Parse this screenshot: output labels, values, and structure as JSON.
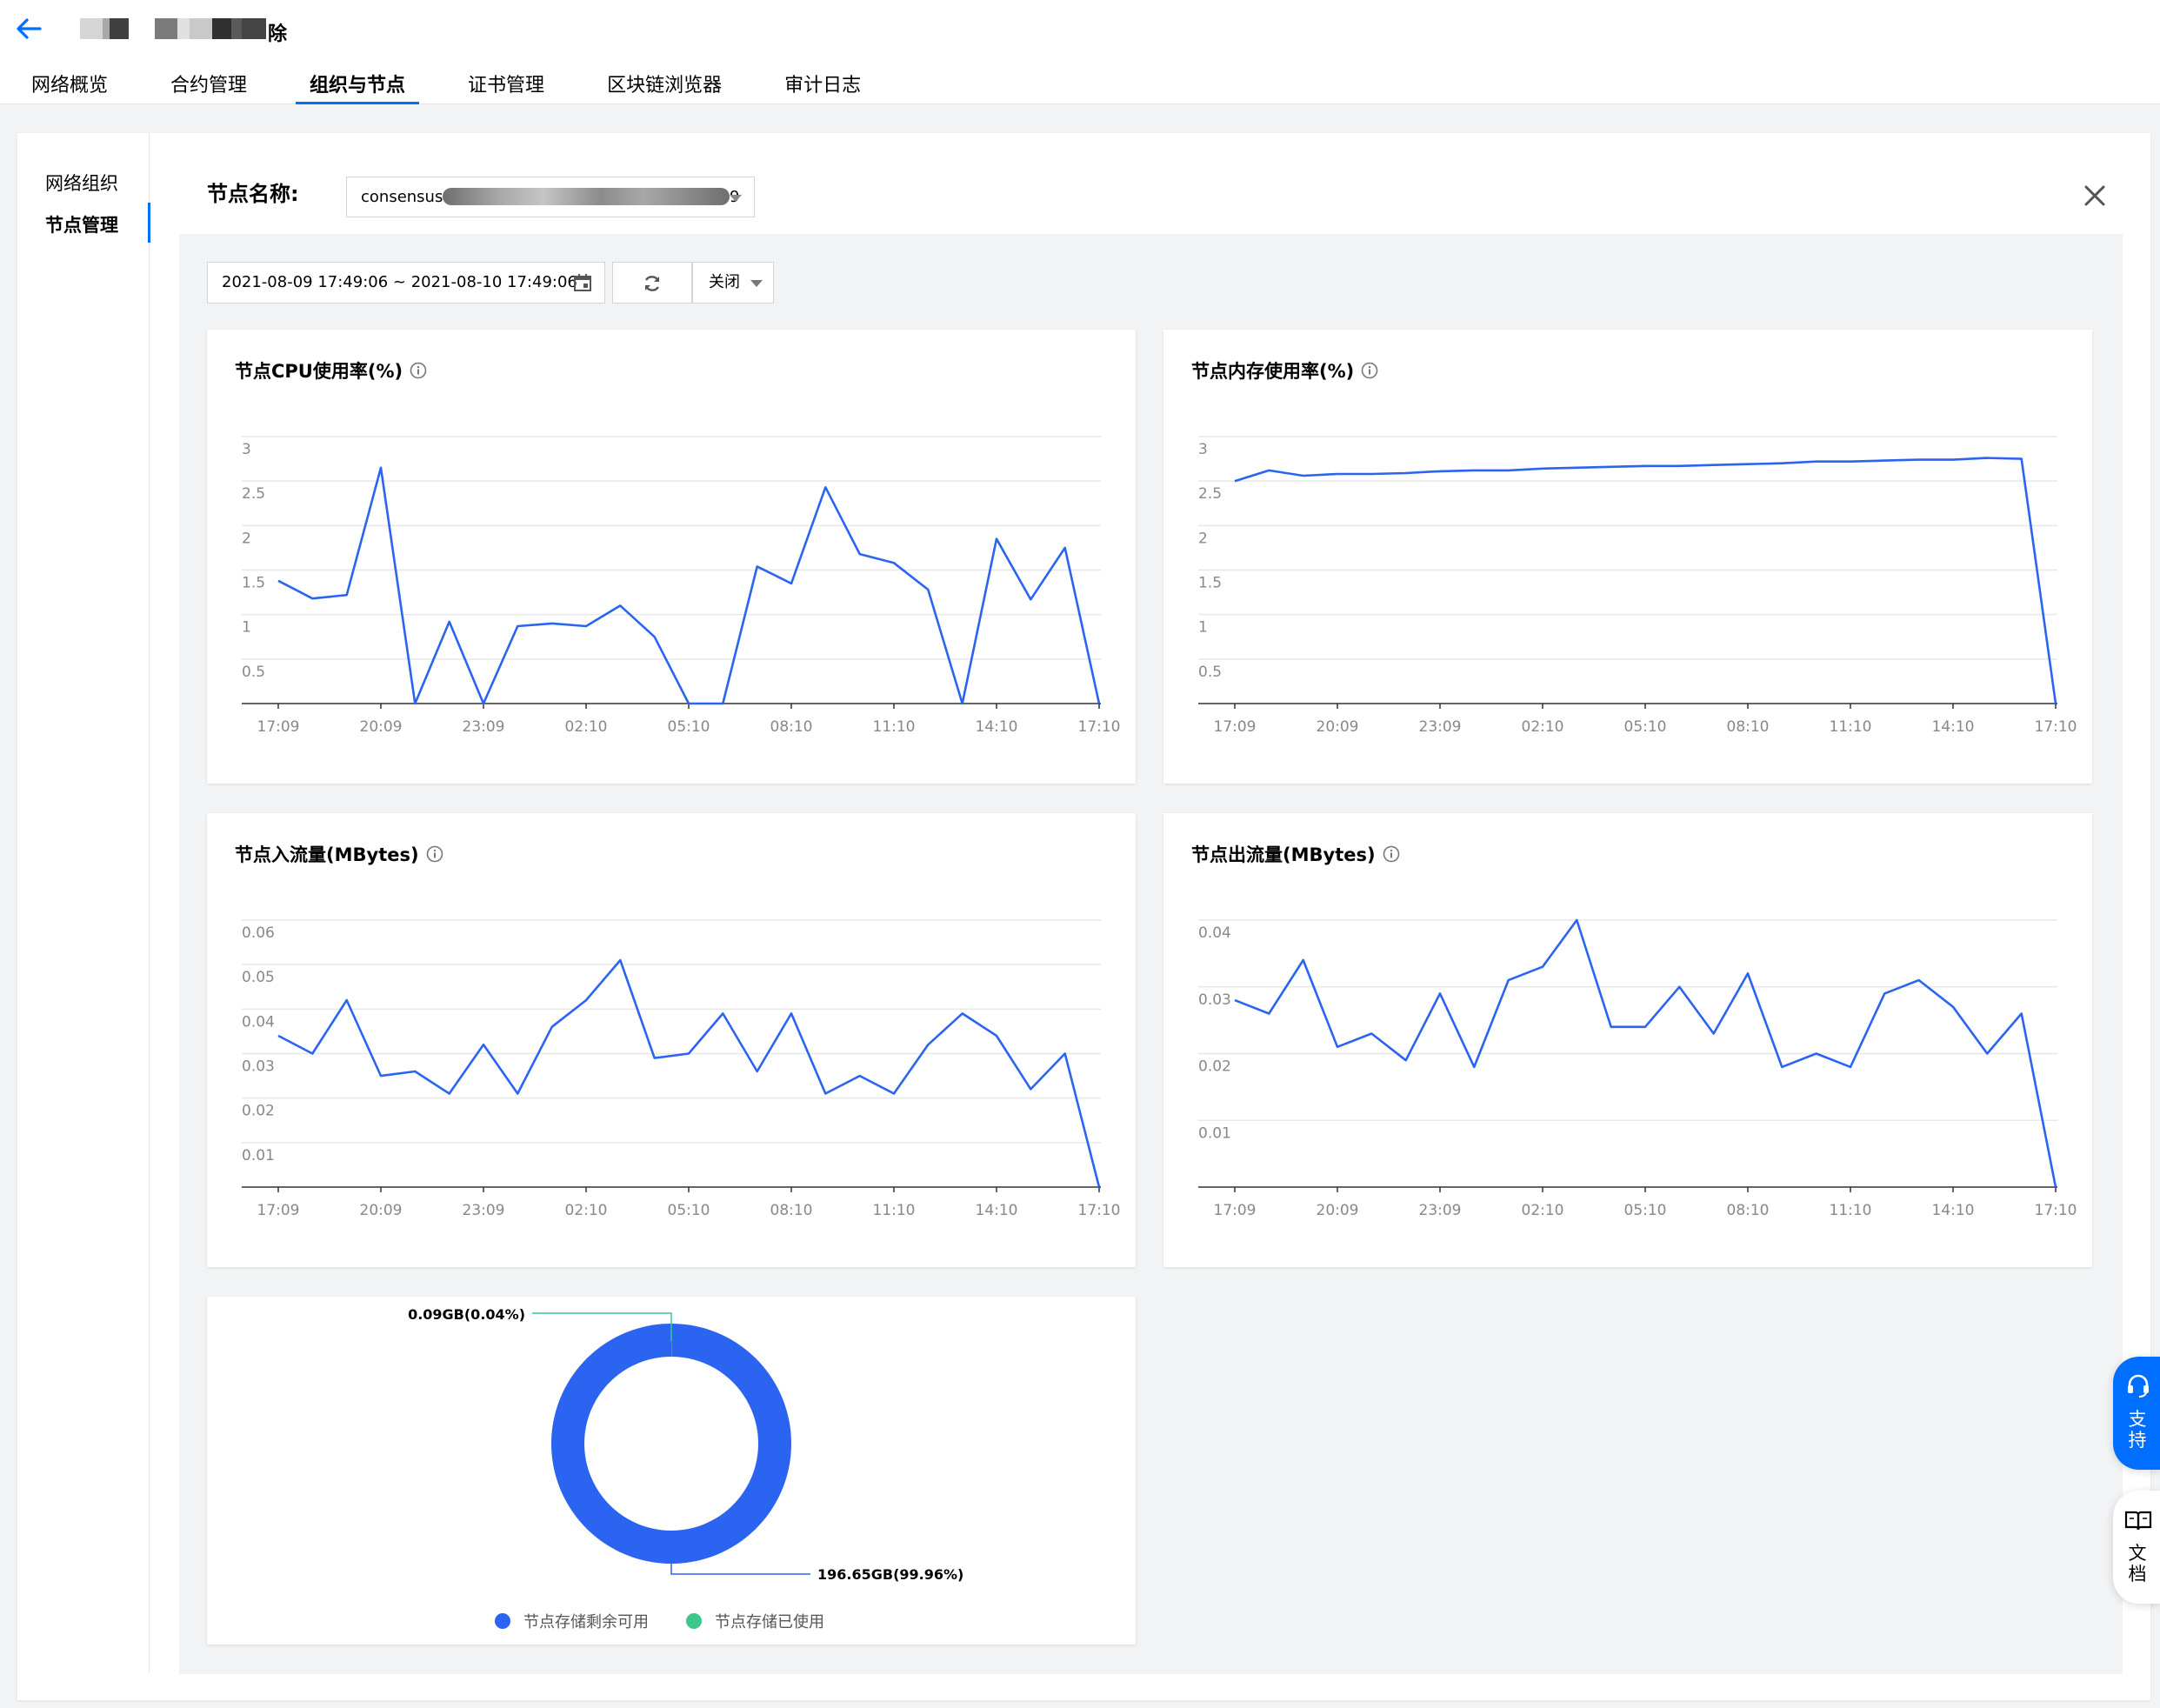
{
  "header": {
    "title_visible_char": "除",
    "tabs": [
      {
        "label": "网络概览",
        "active": false
      },
      {
        "label": "合约管理",
        "active": false
      },
      {
        "label": "组织与节点",
        "active": true
      },
      {
        "label": "证书管理",
        "active": false
      },
      {
        "label": "区块链浏览器",
        "active": false
      },
      {
        "label": "审计日志",
        "active": false
      }
    ]
  },
  "sidebar": {
    "items": [
      {
        "label": "网络组织",
        "active": false
      },
      {
        "label": "节点管理",
        "active": true
      }
    ]
  },
  "node_selector": {
    "label": "节点名称:",
    "value_prefix": "consensus",
    "value_suffix": "9"
  },
  "toolbar": {
    "date_range": "2021-08-09 17:49:06 ~ 2021-08-10 17:49:06",
    "interval": "关闭"
  },
  "colors": {
    "accent": "#006eff",
    "line": "#2b64f0",
    "donut_primary": "#2b64f0",
    "donut_secondary": "#3ec78a"
  },
  "chart_data": [
    {
      "type": "line",
      "title": "节点CPU使用率(%)",
      "x_ticks": [
        "17:09",
        "20:09",
        "23:09",
        "02:10",
        "05:10",
        "08:10",
        "11:10",
        "14:10",
        "17:10"
      ],
      "y_ticks": [
        "3",
        "2.5",
        "2",
        "1.5",
        "1",
        "0.5"
      ],
      "ylim": [
        0,
        3
      ],
      "values": [
        1.38,
        1.18,
        1.22,
        2.65,
        0,
        0.92,
        0,
        0.87,
        0.9,
        0.87,
        1.1,
        0.75,
        0,
        0,
        1.54,
        1.35,
        2.43,
        1.68,
        1.58,
        1.28,
        0,
        1.85,
        1.17,
        1.75,
        0
      ]
    },
    {
      "type": "line",
      "title": "节点内存使用率(%)",
      "x_ticks": [
        "17:09",
        "20:09",
        "23:09",
        "02:10",
        "05:10",
        "08:10",
        "11:10",
        "14:10",
        "17:10"
      ],
      "y_ticks": [
        "3",
        "2.5",
        "2",
        "1.5",
        "1",
        "0.5"
      ],
      "ylim": [
        0,
        3
      ],
      "values": [
        2.5,
        2.62,
        2.56,
        2.58,
        2.58,
        2.59,
        2.61,
        2.62,
        2.62,
        2.64,
        2.65,
        2.66,
        2.67,
        2.67,
        2.68,
        2.69,
        2.7,
        2.72,
        2.72,
        2.73,
        2.74,
        2.74,
        2.76,
        2.75,
        0
      ]
    },
    {
      "type": "line",
      "title": "节点入流量(MBytes)",
      "x_ticks": [
        "17:09",
        "20:09",
        "23:09",
        "02:10",
        "05:10",
        "08:10",
        "11:10",
        "14:10",
        "17:10"
      ],
      "y_ticks": [
        "0.06",
        "0.05",
        "0.04",
        "0.03",
        "0.02",
        "0.01"
      ],
      "ylim": [
        0,
        0.06
      ],
      "values": [
        0.034,
        0.03,
        0.042,
        0.025,
        0.026,
        0.021,
        0.032,
        0.021,
        0.036,
        0.042,
        0.051,
        0.029,
        0.03,
        0.039,
        0.026,
        0.039,
        0.021,
        0.025,
        0.021,
        0.032,
        0.039,
        0.034,
        0.022,
        0.03,
        0
      ]
    },
    {
      "type": "line",
      "title": "节点出流量(MBytes)",
      "x_ticks": [
        "17:09",
        "20:09",
        "23:09",
        "02:10",
        "05:10",
        "08:10",
        "11:10",
        "14:10",
        "17:10"
      ],
      "y_ticks": [
        "0.04",
        "0.03",
        "0.02",
        "0.01"
      ],
      "ylim": [
        0,
        0.04
      ],
      "values": [
        0.028,
        0.026,
        0.034,
        0.021,
        0.023,
        0.019,
        0.029,
        0.018,
        0.031,
        0.033,
        0.04,
        0.024,
        0.024,
        0.03,
        0.023,
        0.032,
        0.018,
        0.02,
        0.018,
        0.029,
        0.031,
        0.027,
        0.02,
        0.026,
        0
      ]
    },
    {
      "type": "pie",
      "labels": [
        "节点存储剩余可用",
        "节点存储已使用"
      ],
      "values": [
        196.65,
        0.09
      ],
      "slice_labels": [
        "196.65GB(99.96%)",
        "0.09GB(0.04%)"
      ]
    }
  ],
  "floating": {
    "support": "支持",
    "docs": "文档"
  }
}
